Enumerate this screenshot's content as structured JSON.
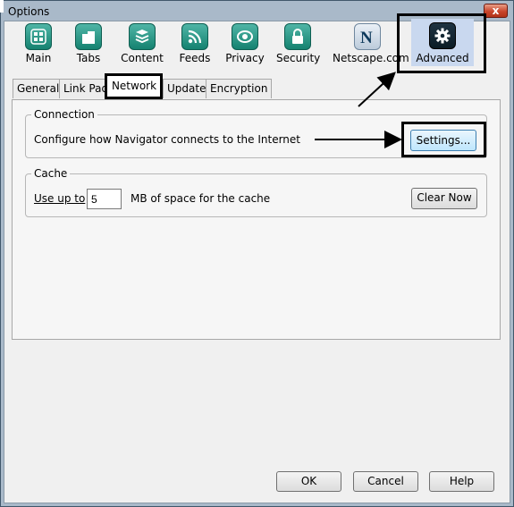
{
  "window": {
    "title": "Options",
    "close_glyph": "x"
  },
  "panes": [
    {
      "label": "Main",
      "icon": "main-icon"
    },
    {
      "label": "Tabs",
      "icon": "tabs-icon"
    },
    {
      "label": "Content",
      "icon": "content-icon"
    },
    {
      "label": "Feeds",
      "icon": "feeds-icon"
    },
    {
      "label": "Privacy",
      "icon": "privacy-icon"
    },
    {
      "label": "Security",
      "icon": "security-icon"
    },
    {
      "label": "Netscape.com",
      "icon": "netscape-icon"
    },
    {
      "label": "Advanced",
      "icon": "gear-icon",
      "selected": true
    }
  ],
  "tabs": [
    {
      "label": "General"
    },
    {
      "label": "Link Pad"
    },
    {
      "label": "Network",
      "selected": true
    },
    {
      "label": "Update"
    },
    {
      "label": "Encryption"
    }
  ],
  "connection": {
    "legend": "Connection",
    "description": "Configure how Navigator connects to the Internet",
    "settings_label": "Settings..."
  },
  "cache": {
    "legend": "Cache",
    "use_up_to": "Use up to",
    "value": "5",
    "unit_text": "MB of space for the cache",
    "clear_label": "Clear Now"
  },
  "dialog_buttons": {
    "ok": "OK",
    "cancel": "Cancel",
    "help": "Help"
  },
  "colors": {
    "accent": "#1a8a77",
    "selected_pane": "#c9d8ef",
    "annotation": "#000000"
  }
}
